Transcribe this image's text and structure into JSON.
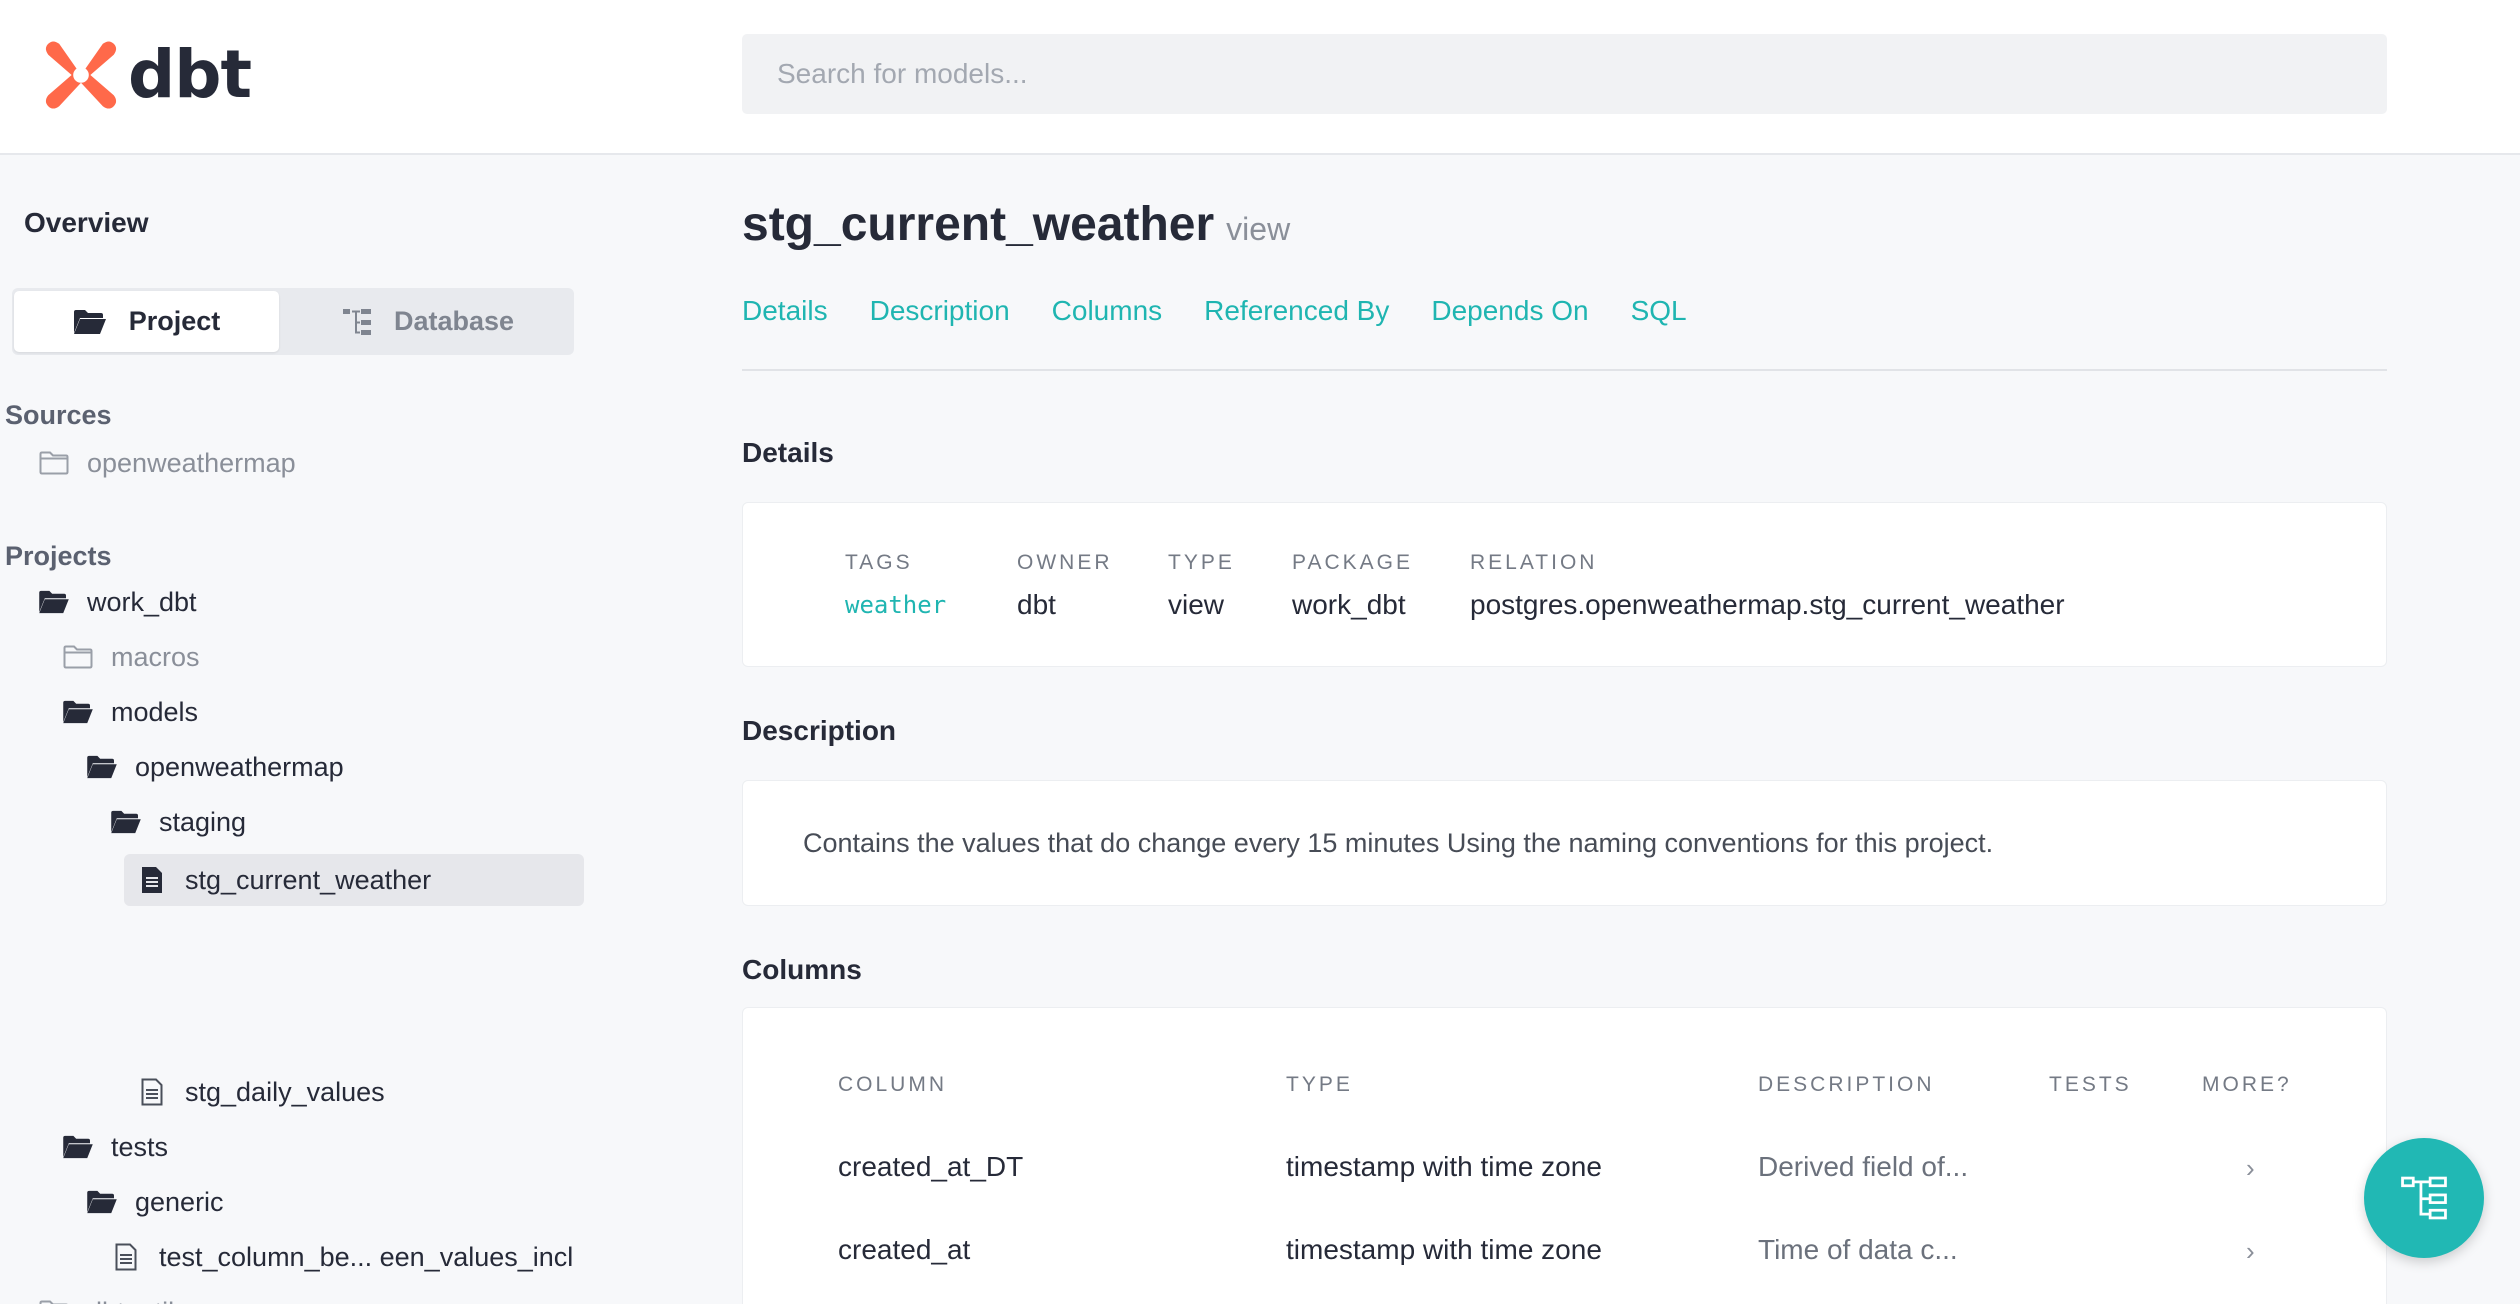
{
  "header": {
    "logo_text": "dbt",
    "search_placeholder": "Search for models...",
    "brand_color": "#ff694a"
  },
  "sidebar": {
    "overview_label": "Overview",
    "toggle": {
      "project_label": "Project",
      "database_label": "Database",
      "active": "Project"
    },
    "sources_title": "Sources",
    "sources": [
      {
        "label": "openweathermap",
        "icon": "folder-closed-icon"
      }
    ],
    "projects_title": "Projects",
    "tree": [
      {
        "label": "work_dbt",
        "icon": "folder-open-icon"
      },
      {
        "label": "macros",
        "icon": "folder-closed-icon"
      },
      {
        "label": "models",
        "icon": "folder-open-icon"
      },
      {
        "label": "openweathermap",
        "icon": "folder-open-icon"
      },
      {
        "label": "staging",
        "icon": "folder-open-icon"
      },
      {
        "label": "stg_current_weather",
        "icon": "file-filled-icon",
        "selected": true
      },
      {
        "label": "stg_daily_values",
        "icon": "file-outline-icon"
      },
      {
        "label": "tests",
        "icon": "folder-open-icon"
      },
      {
        "label": "generic",
        "icon": "folder-open-icon"
      },
      {
        "label": "test_column_be... een_values_incl",
        "icon": "file-outline-icon"
      },
      {
        "label": "dbt_utils",
        "icon": "folder-closed-icon"
      }
    ]
  },
  "main": {
    "title": "stg_current_weather",
    "kind": "view",
    "tabs": [
      "Details",
      "Description",
      "Columns",
      "Referenced By",
      "Depends On",
      "SQL"
    ],
    "details": {
      "heading": "Details",
      "fields": [
        {
          "label": "TAGS",
          "value": "weather"
        },
        {
          "label": "OWNER",
          "value": "dbt"
        },
        {
          "label": "TYPE",
          "value": "view"
        },
        {
          "label": "PACKAGE",
          "value": "work_dbt"
        },
        {
          "label": "RELATION",
          "value": "postgres.openweathermap.stg_current_weather"
        }
      ]
    },
    "description": {
      "heading": "Description",
      "text": "Contains the values that do change every 15 minutes Using the naming conventions for this project."
    },
    "columns": {
      "heading": "Columns",
      "headers": [
        "COLUMN",
        "TYPE",
        "DESCRIPTION",
        "TESTS",
        "MORE?"
      ],
      "rows": [
        {
          "name": "created_at_DT",
          "type": "timestamp with time zone",
          "description": "Derived field of...",
          "tests": "",
          "more": "›"
        },
        {
          "name": "created_at",
          "type": "timestamp with time zone",
          "description": "Time of data c...",
          "tests": "",
          "more": "›"
        }
      ]
    }
  },
  "accent_color": "#1fb5b1"
}
